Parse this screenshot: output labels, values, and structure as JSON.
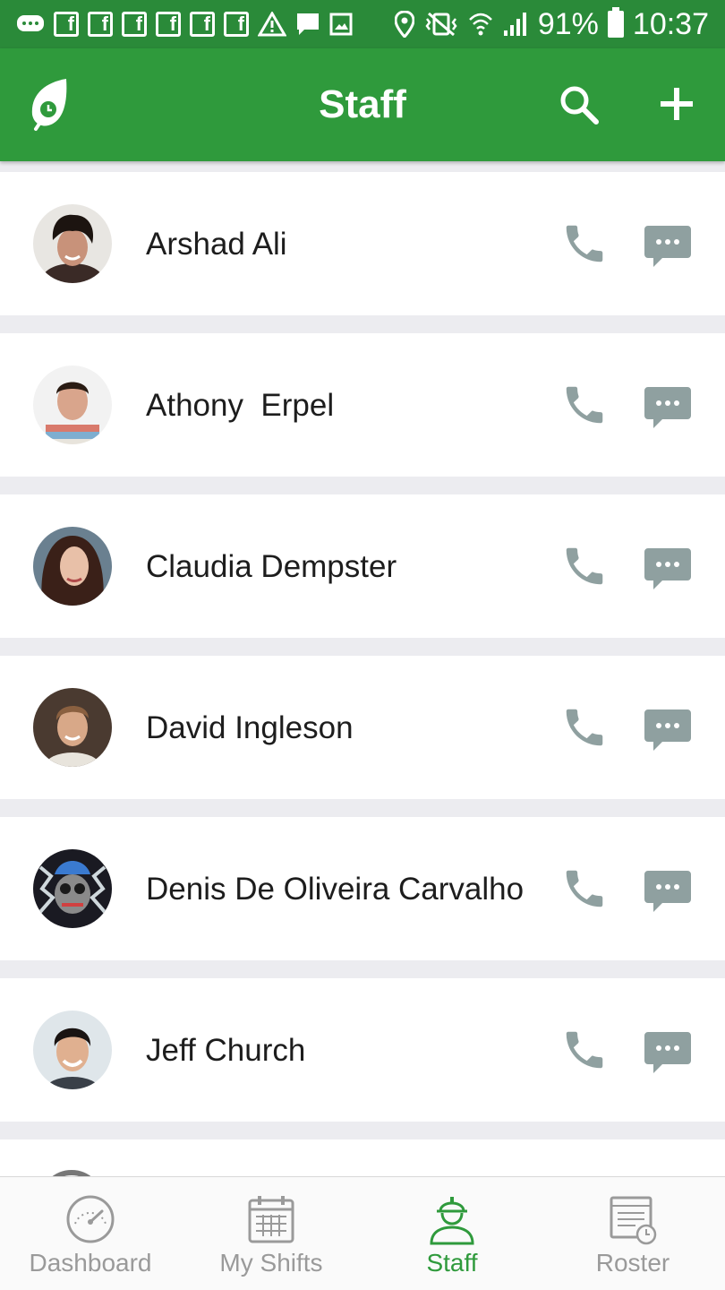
{
  "status_bar": {
    "fb_glyph": "f",
    "battery_text": "91%",
    "time": "10:37"
  },
  "app_bar": {
    "title": "Staff"
  },
  "staff": [
    {
      "name": "Arshad Ali"
    },
    {
      "name": "Athony  Erpel"
    },
    {
      "name": "Claudia Dempster"
    },
    {
      "name": "David Ingleson"
    },
    {
      "name": "Denis De Oliveira Carvalho"
    },
    {
      "name": "Jeff Church"
    }
  ],
  "bottom_nav": {
    "items": [
      {
        "label": "Dashboard",
        "icon": "speedometer-icon",
        "active": false
      },
      {
        "label": "My Shifts",
        "icon": "calendar-icon",
        "active": false
      },
      {
        "label": "Staff",
        "icon": "worker-hardhat-icon",
        "active": true
      },
      {
        "label": "Roster",
        "icon": "roster-clock-icon",
        "active": false
      }
    ]
  },
  "colors": {
    "primary": "#2f9a3c",
    "status_bar": "#2a8a39",
    "action_icon": "#8fa0a0",
    "inactive_nav": "#9a9a9a"
  }
}
